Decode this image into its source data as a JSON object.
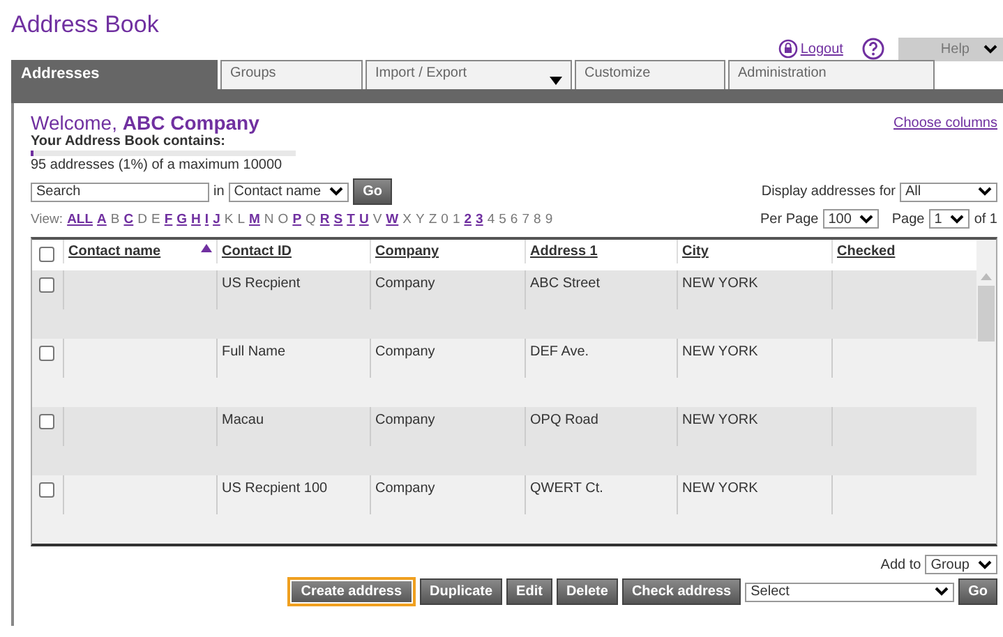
{
  "app_title": "Address Book",
  "header_links": [
    {
      "kind": "logout",
      "label": "Logout"
    },
    {
      "kind": "help",
      "label": "Help"
    }
  ],
  "tabs": [
    {
      "label": "Addresses",
      "selected": true,
      "dropdown": false
    },
    {
      "label": "Groups",
      "selected": false,
      "dropdown": false
    },
    {
      "label": "Import / Export",
      "selected": false,
      "dropdown": true
    },
    {
      "label": "Customize",
      "selected": false,
      "dropdown": false
    },
    {
      "label": "Administration",
      "selected": false,
      "dropdown": false
    }
  ],
  "welcome": {
    "greeting": "Welcome,",
    "company": "ABC Company",
    "choose_columns": "Choose columns"
  },
  "usage": {
    "label": "Your Address Book contains:",
    "level": 0.01,
    "summary": "95 addresses (1%) of a maximum 10000"
  },
  "search": {
    "placeholder": "Search",
    "in_label": "in",
    "field": "Contact name",
    "go": "Go"
  },
  "display_for": {
    "label": "Display addresses for",
    "value": "All"
  },
  "view": {
    "label": "View:",
    "letters": [
      {
        "label": "ALL",
        "linked": true
      },
      {
        "label": "A",
        "linked": true
      },
      {
        "label": "B",
        "linked": false
      },
      {
        "label": "C",
        "linked": true
      },
      {
        "label": "D",
        "linked": false
      },
      {
        "label": "E",
        "linked": false
      },
      {
        "label": "F",
        "linked": true
      },
      {
        "label": "G",
        "linked": true
      },
      {
        "label": "H",
        "linked": true
      },
      {
        "label": "I",
        "linked": true
      },
      {
        "label": "J",
        "linked": true
      },
      {
        "label": "K",
        "linked": false
      },
      {
        "label": "L",
        "linked": false
      },
      {
        "label": "M",
        "linked": true
      },
      {
        "label": "N",
        "linked": false
      },
      {
        "label": "O",
        "linked": false
      },
      {
        "label": "P",
        "linked": true
      },
      {
        "label": "Q",
        "linked": false
      },
      {
        "label": "R",
        "linked": true
      },
      {
        "label": "S",
        "linked": true
      },
      {
        "label": "T",
        "linked": true
      },
      {
        "label": "U",
        "linked": true
      },
      {
        "label": "V",
        "linked": false
      },
      {
        "label": "W",
        "linked": true
      },
      {
        "label": "X",
        "linked": false
      },
      {
        "label": "Y",
        "linked": false
      },
      {
        "label": "Z",
        "linked": false
      },
      {
        "label": "0",
        "linked": false
      },
      {
        "label": "1",
        "linked": false
      },
      {
        "label": "2",
        "linked": true
      },
      {
        "label": "3",
        "linked": true
      },
      {
        "label": "4",
        "linked": false
      },
      {
        "label": "5",
        "linked": false
      },
      {
        "label": "6",
        "linked": false
      },
      {
        "label": "7",
        "linked": false
      },
      {
        "label": "8",
        "linked": false
      },
      {
        "label": "9",
        "linked": false
      }
    ]
  },
  "paging": {
    "per_page_label": "Per Page",
    "per_page": "100",
    "page_label": "Page",
    "page": "1",
    "of": "of 1"
  },
  "table": {
    "select_all_checked": false,
    "columns": [
      {
        "label": "Contact name",
        "sorted": true
      },
      {
        "label": "Contact ID",
        "sorted": false
      },
      {
        "label": "Company",
        "sorted": false
      },
      {
        "label": "Address 1",
        "sorted": false
      },
      {
        "label": "City",
        "sorted": false
      },
      {
        "label": "Checked",
        "sorted": false
      }
    ],
    "rows": [
      {
        "checked": false,
        "cells": [
          "",
          "US Recpient",
          "Company",
          "ABC Street",
          "NEW YORK",
          ""
        ]
      },
      {
        "checked": false,
        "cells": [
          "",
          "Full Name",
          "Company",
          "DEF Ave.",
          "NEW YORK",
          ""
        ]
      },
      {
        "checked": false,
        "cells": [
          "",
          "Macau",
          "Company",
          "OPQ Road",
          "NEW YORK",
          ""
        ]
      },
      {
        "checked": false,
        "cells": [
          "",
          "US Recpient 100",
          "Company",
          "QWERT Ct.",
          "NEW YORK",
          ""
        ]
      }
    ]
  },
  "add_to": {
    "label": "Add to",
    "value": "Group"
  },
  "actions": [
    {
      "label": "Create address",
      "highlighted": true
    },
    {
      "label": "Duplicate",
      "highlighted": false
    },
    {
      "label": "Edit",
      "highlighted": false
    },
    {
      "label": "Delete",
      "highlighted": false
    },
    {
      "label": "Check address",
      "highlighted": false
    }
  ],
  "action_select": {
    "value": "Select",
    "go": "Go"
  }
}
